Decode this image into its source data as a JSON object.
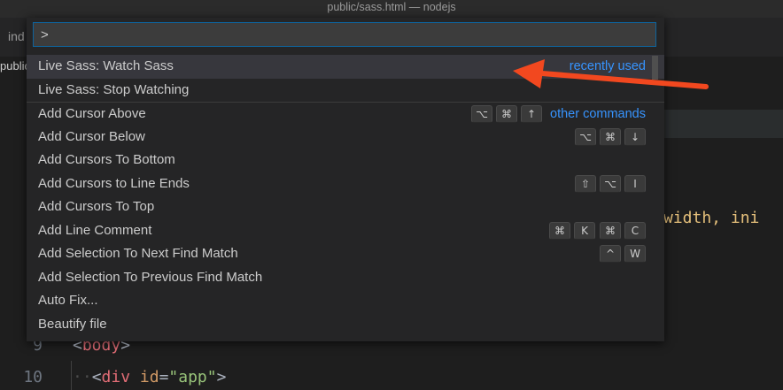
{
  "window": {
    "title": "public/sass.html — nodejs"
  },
  "tab_fragment": "ind",
  "breadcrumb_fragment": "public",
  "code_fragment": "width, ini",
  "editor_lines": [
    {
      "number": "9",
      "open": "<",
      "tag": "body",
      "close": ">"
    },
    {
      "number": "10",
      "indent": "··",
      "open": "<",
      "tag": "div",
      "attr": "id",
      "eq": "=",
      "value": "\"app\"",
      "close": ">"
    }
  ],
  "palette": {
    "input_value": ">",
    "items": [
      {
        "label": "Live Sass: Watch Sass",
        "hint": "recently used"
      },
      {
        "label": "Live Sass: Stop Watching"
      },
      {
        "label": "Add Cursor Above",
        "keys": [
          [
            "⌥",
            "⌘",
            "↑"
          ]
        ],
        "hint": "other commands"
      },
      {
        "label": "Add Cursor Below",
        "keys": [
          [
            "⌥",
            "⌘",
            "↓"
          ]
        ]
      },
      {
        "label": "Add Cursors To Bottom"
      },
      {
        "label": "Add Cursors to Line Ends",
        "keys": [
          [
            "⇧",
            "⌥",
            "I"
          ]
        ]
      },
      {
        "label": "Add Cursors To Top"
      },
      {
        "label": "Add Line Comment",
        "keys": [
          [
            "⌘",
            "K"
          ],
          [
            "⌘",
            "C"
          ]
        ]
      },
      {
        "label": "Add Selection To Next Find Match",
        "keys": [
          [
            "^",
            "W"
          ]
        ]
      },
      {
        "label": "Add Selection To Previous Find Match"
      },
      {
        "label": "Auto Fix..."
      },
      {
        "label": "Beautify file"
      }
    ]
  },
  "colors": {
    "arrow": "#f2481f",
    "hint": "#3794ff",
    "active_row": "#37373d"
  }
}
